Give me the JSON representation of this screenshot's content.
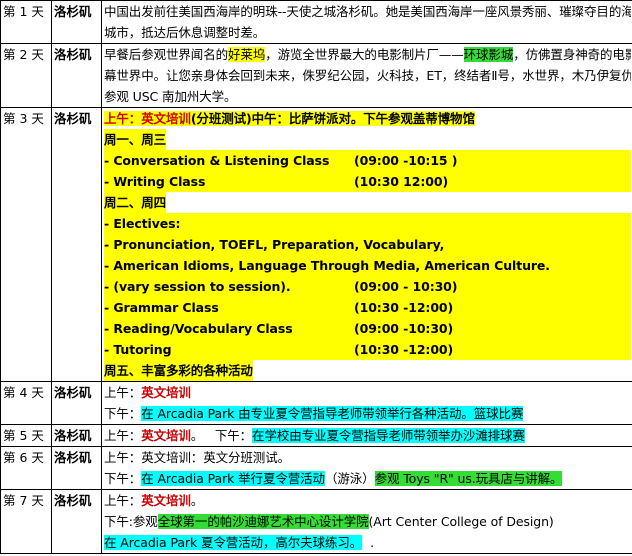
{
  "city": "洛杉矶",
  "colors": {
    "highlight_yellow": "#ffff00",
    "highlight_cyan": "#00ffff",
    "highlight_green": "#33dd33",
    "training_red": "#cc0000"
  },
  "days": [
    {
      "day": "第 1 天",
      "line1": "中国出发前往美国西海岸的明珠--天使之城洛杉矶。她是美国西海岸一座风景秀丽、璀璨夺目的海滨",
      "line2": "城市，抵达后休息调整时差。"
    },
    {
      "day": "第 2 天",
      "l1a": "早餐后参观世界闻名的",
      "l1b": "好莱坞",
      "l1c": "，游览全世界最大的电影制片厂——",
      "l1d": "环球影城",
      "l1e": "，仿佛置身神奇的电影银",
      "line2": "幕世界中。让您亲身体会回到未来，侏罗纪公园，火科技，ET，终结者Ⅱ号，水世界，木乃伊复仇等。",
      "line3": "参观 USC 南加州大学。"
    },
    {
      "day": "第 3 天",
      "l1a": "上午：",
      "l1b": "英文培训",
      "l1c": "(分班测试)中午：比萨饼派对。下午参观盖蒂博物馆",
      "mon_wed": "周一、周三",
      "c1_name": "- Conversation & Listening Class",
      "c1_time": "(09:00 -10:15 )",
      "c2_name": "- Writing Class",
      "c2_time": "(10:30 12:00)",
      "tue_thu": "周二、周四",
      "electives": "- Electives:",
      "e1": "- Pronunciation, TOEFL, Preparation, Vocabulary,",
      "e2": "- American Idioms, Language Through Media, American Culture.",
      "e3_name": "- (vary session to session).",
      "e3_time": "(09:00 - 10:30)",
      "e4_name": "- Grammar Class",
      "e4_time": "(10:30 -12:00)",
      "e5_name": "- Reading/Vocabulary Class",
      "e5_time": "(09:00 -10:30)",
      "e6_name": "- Tutoring",
      "e6_time": "(10:30 -12:00)",
      "fri": "周五、丰富多彩的各种活动"
    },
    {
      "day": "第 4 天",
      "l1a": "上午：",
      "l1b": "英文培训",
      "l2a": "下午：",
      "l2b": "在 Arcadia Park 由专业夏令营指导老师带领举行各种活动。篮球比赛"
    },
    {
      "day": "第 5 天",
      "l1a": "上午：",
      "l1b": "英文培训",
      "l1c": "。   下午：",
      "l1d": "在学校由专业夏令营指导老师带领举办沙滩排球赛"
    },
    {
      "day": "第 6 天",
      "line1": "上午：英文培训：英文分班测试。",
      "l2a": "下午：",
      "l2b": "在 Arcadia Park 举行夏令营活动",
      "l2c": "（游泳）",
      "l2d": "参观 Toys \"R\" us.玩具店与讲解。"
    },
    {
      "day": "第 7 天",
      "l1a": "上午：",
      "l1b": "英文培训",
      "l1c": "。",
      "l2a": "下午:参观",
      "l2b": "全球第一的帕沙迪娜艺术中心设计学院",
      "l2c": "(Art Center College of Design)",
      "l3a": "在 Arcadia Park 夏令营活动，高尔夫球练习。",
      "l3b": "."
    }
  ]
}
